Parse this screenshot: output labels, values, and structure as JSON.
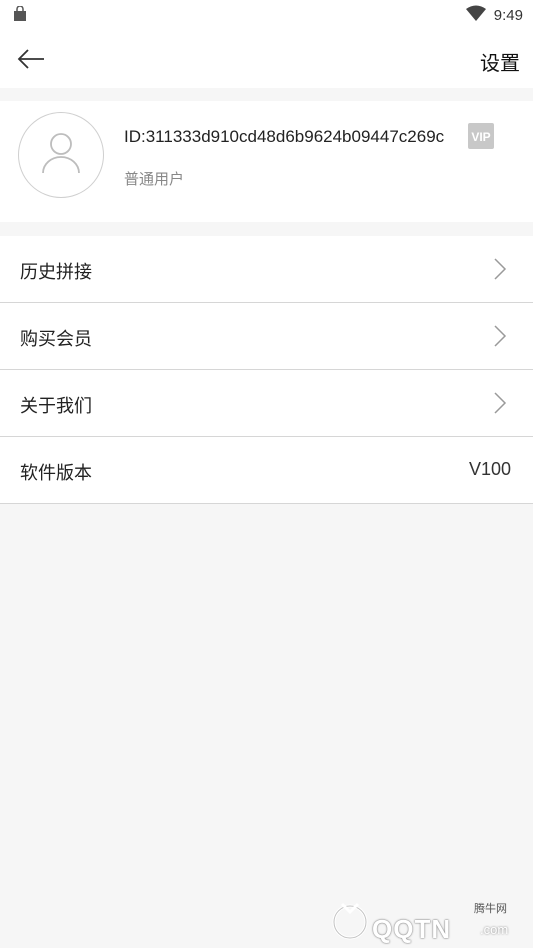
{
  "status_bar": {
    "time": "9:49",
    "left_icon": "shopping-bag-icon",
    "wifi_icon": "wifi-icon",
    "battery_icon": "battery-icon"
  },
  "app_bar": {
    "back_icon": "arrow-left-icon",
    "title": "设置"
  },
  "profile": {
    "avatar_icon": "user-avatar-icon",
    "user_id": "ID:311333d910cd48d6b9624b09447c269c",
    "vip_badge": "VIP",
    "user_type": "普通用户"
  },
  "menu": {
    "items": [
      {
        "label": "历史拼接",
        "icon": "chevron-right-icon"
      },
      {
        "label": "购买会员",
        "icon": "chevron-right-icon"
      },
      {
        "label": "关于我们",
        "icon": "chevron-right-icon"
      }
    ],
    "version": {
      "label": "软件版本",
      "value": "V100"
    }
  },
  "watermark": {
    "small_text": "腾牛网",
    "big_text": "QQTN",
    "suffix": ".com"
  }
}
